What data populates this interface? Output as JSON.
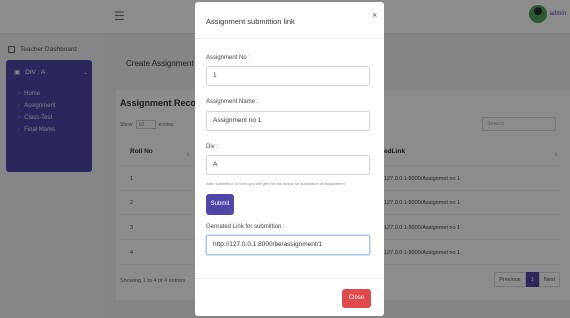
{
  "topbar": {
    "menu_icon": "hamburger-icon",
    "username": "admin"
  },
  "sidebar": {
    "dashboard_label": "Teacher Dashboard",
    "division_label": "DIV : A",
    "items": [
      {
        "label": "Home"
      },
      {
        "label": "Assignment"
      },
      {
        "label": "Class-Test"
      },
      {
        "label": "Final Marks"
      }
    ]
  },
  "main": {
    "title": "Create Assignment sub",
    "card_title": "Assignment Record",
    "show_label": "Show",
    "show_value": "10",
    "entries_label": "entries",
    "search_placeholder": "Search",
    "columns": {
      "roll": "Roll No",
      "link": "edLink"
    },
    "rows": [
      {
        "roll": "1",
        "link": "127.0.0.1:8000/Assignmet no 1"
      },
      {
        "roll": "2",
        "link": "127.0.0.1:8000/Assignmet no 1"
      },
      {
        "roll": "3",
        "link": "127.0.0.1:8000/Assignmet no 1"
      },
      {
        "roll": "4",
        "link": "127.0.0.1:8000/Assignmet no 1"
      }
    ],
    "showing_text": "Showing 1 to 4 of 4 entries",
    "pager": {
      "prev": "Previous",
      "current": "1",
      "next": "Next"
    }
  },
  "modal": {
    "title": "Assignment submittion link",
    "close_x": "×",
    "fields": {
      "no_label": "Assignment No :",
      "no_value": "1",
      "name_label": "Assignment Name :",
      "name_value": "Assignment no 1",
      "div_label": "Div :",
      "div_value": "A"
    },
    "hint": "After submittion of form you will get the link below for submittion of assignment",
    "submit_label": "Submit",
    "link_label": "Genrated Link for submittion :",
    "link_value": "http://127.0.0.1:8000/be/assignment/1",
    "close_label": "Close"
  },
  "colors": {
    "accent": "#4f47a8",
    "danger": "#e14a4a"
  }
}
